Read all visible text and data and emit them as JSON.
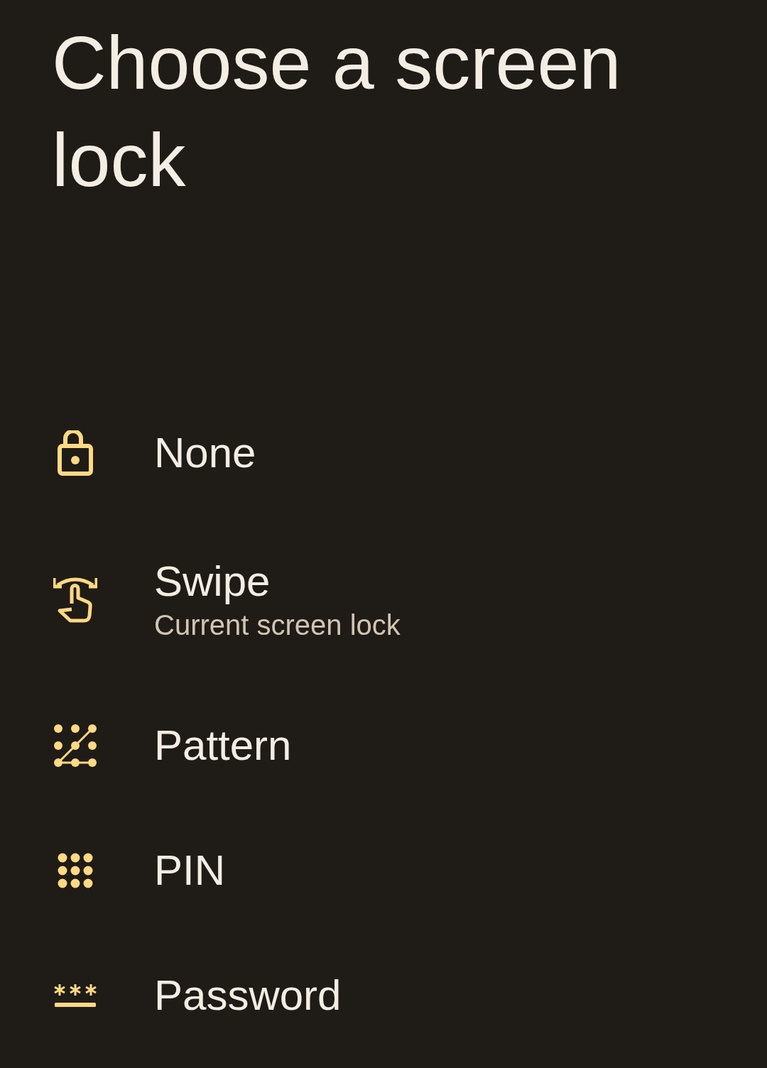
{
  "title": "Choose a screen lock",
  "options": [
    {
      "kind": "unlocked",
      "label": "None"
    },
    {
      "kind": "swipe",
      "label": "Swipe",
      "summary": "Current screen lock"
    },
    {
      "kind": "pattern",
      "label": "Pattern"
    },
    {
      "kind": "pin",
      "label": "PIN"
    },
    {
      "kind": "password",
      "label": "Password"
    }
  ]
}
